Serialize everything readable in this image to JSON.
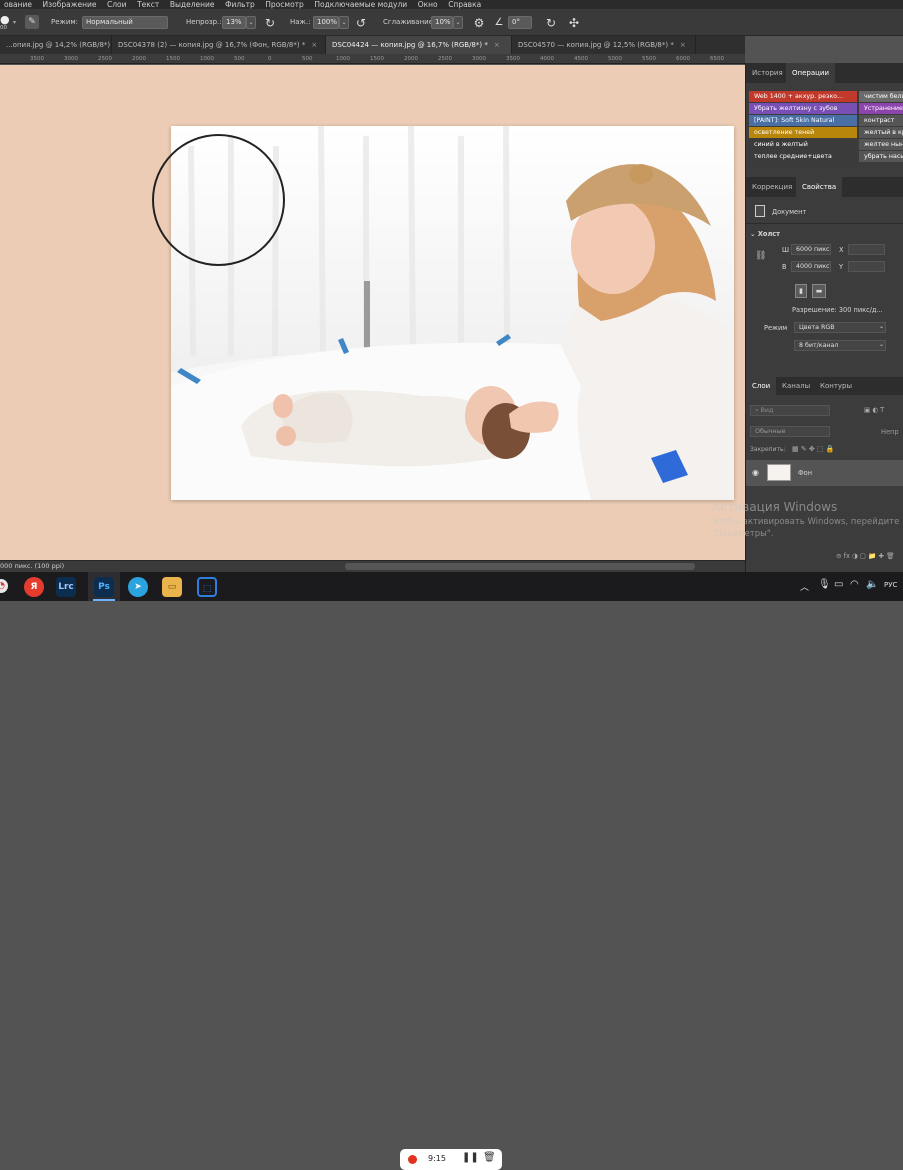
{
  "menu": [
    "ование",
    "Изображение",
    "Слои",
    "Текст",
    "Выделение",
    "Фильтр",
    "Просмотр",
    "Подключаемые модули",
    "Окно",
    "Справка"
  ],
  "options": {
    "mode_label": "Режим:",
    "mode_value": "Нормальный",
    "opacity_label": "Непрозр.:",
    "opacity_value": "13%",
    "pressure_label": "Наж.:",
    "pressure_value": "100%",
    "smoothing_label": "Сглаживание:",
    "smoothing_value": "10%",
    "angle_value": "0°",
    "brush_size": "00"
  },
  "tabs": [
    {
      "label": "...опия.jpg @ 14,2% (RGB/8*) *"
    },
    {
      "label": "DSC04378 (2) — копия.jpg @ 16,7% (Фон, RGB/8*) *"
    },
    {
      "label": "DSC04424 — копия.jpg @ 16,7% (RGB/8*) *"
    },
    {
      "label": "DSC04570 — копия.jpg @ 12,5% (RGB/8*) *"
    }
  ],
  "ruler_ticks": [
    "3500",
    "3000",
    "2500",
    "2000",
    "1500",
    "1000",
    "500",
    "0",
    "500",
    "1000",
    "1500",
    "2000",
    "2500",
    "3000",
    "3500",
    "4000",
    "4500",
    "5000",
    "5500",
    "6000",
    "6500",
    "7000"
  ],
  "status": "000 пикс. (100 ppi)",
  "panels": {
    "history_tab": "История",
    "actions_tab": "Операции",
    "actions_left": [
      {
        "label": "Web 1400 + акхур. резко...",
        "color": "#c0392b"
      },
      {
        "label": "Убрать желтизну с зубов",
        "color": "#7a4fb5"
      },
      {
        "label": "[PAINT]: Soft Skin Natural",
        "color": "#4a6fa5"
      },
      {
        "label": "осветление теней",
        "color": "#b8860b"
      },
      {
        "label": "синий в желтый",
        "color": "#3b3b3b"
      },
      {
        "label": "теплее средние+цвета",
        "color": "#3b3b3b"
      }
    ],
    "actions_right": [
      {
        "label": "чистим белый",
        "color": "#6a6a6a"
      },
      {
        "label": "Устранение...",
        "color": "#8e44ad"
      },
      {
        "label": "контраст",
        "color": "#555555"
      },
      {
        "label": "желтый в кр...",
        "color": "#555555"
      },
      {
        "label": "желтее ныне",
        "color": "#555555"
      },
      {
        "label": "убрать насы...",
        "color": "#555555"
      }
    ],
    "correction_tab": "Коррекция",
    "properties_tab": "Свойства",
    "document_label": "Документ",
    "canvas_label": "Холст",
    "width_label": "Ш",
    "width_value": "6000 пикс",
    "height_label": "В",
    "height_value": "4000 пикс",
    "x_label": "X",
    "y_label": "Y",
    "resolution": "Разрешение: 300 пикс/д...",
    "mode_label": "Режим",
    "mode_value": "Цвета RGB",
    "bits_value": "8 бит/канал",
    "layers_tab": "Слои",
    "channels_tab": "Каналы",
    "contours_tab": "Контуры",
    "search_placeholder": "Вид",
    "blend_value": "Обычные",
    "opacity_short": "Непр",
    "lock_label": "Закрепить:",
    "layer_name": "Фон"
  },
  "watermark": {
    "title": "Активация Windows",
    "line1": "Чтобы активировать Windows, перейдите",
    "line2": "\"Параметры\"."
  },
  "taskbar": {
    "apps": [
      {
        "name": "Я",
        "color": "#e63c2e"
      },
      {
        "name": "Lrc",
        "color": "#0b2e4f"
      },
      {
        "name": "Ps",
        "color": "#0c2d4e"
      },
      {
        "name": "",
        "color": "#2aa3df"
      },
      {
        "name": "",
        "color": "#e9b44c"
      },
      {
        "name": "",
        "color": "#2f7de1"
      }
    ],
    "rec_time": "9:15",
    "lang": "РУС"
  }
}
